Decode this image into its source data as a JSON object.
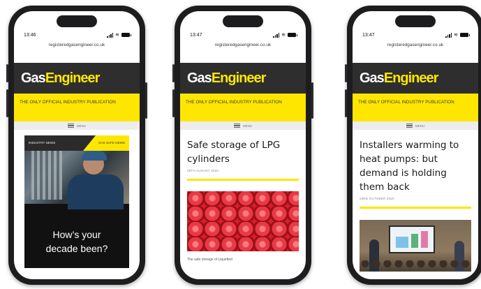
{
  "phones": [
    {
      "time": "13:46",
      "url": "registeredgasengineer.co.uk",
      "logo": {
        "gas": "Gas",
        "engineer": "Engineer"
      },
      "tagline": "THE ONLY OFFICIAL INDUSTRY PUBLICATION",
      "menu_label": "MENU",
      "hero": {
        "tag_left": "INDUSTRY NEWS",
        "tag_right": "GAS SAFE NEWS",
        "text": "How’s your decade been?"
      }
    },
    {
      "time": "13:47",
      "url": "registeredgasengineer.co.uk",
      "logo": {
        "gas": "Gas",
        "engineer": "Engineer"
      },
      "tagline": "THE ONLY OFFICIAL INDUSTRY PUBLICATION",
      "menu_label": "MENU",
      "article": {
        "headline": "Safe storage of LPG cylinders",
        "date": "28TH AUGUST 2020",
        "caption": "The safe storage of Liquefied"
      }
    },
    {
      "time": "13:47",
      "url": "registeredgasengineer.co.uk",
      "logo": {
        "gas": "Gas",
        "engineer": "Engineer"
      },
      "tagline": "THE ONLY OFFICIAL INDUSTRY PUBLICATION",
      "menu_label": "MENU",
      "article": {
        "headline": "Installers warming to heat pumps: but demand is holding them back",
        "date": "23RD OCTOBER 2020"
      }
    }
  ],
  "colors": {
    "brand_yellow": "#ffe600",
    "masthead_dark": "#2e2e2e",
    "phone_frame": "#1d1d1f"
  },
  "icons": [
    "signal-icon",
    "wifi-icon",
    "battery-icon",
    "hamburger-menu-icon"
  ]
}
